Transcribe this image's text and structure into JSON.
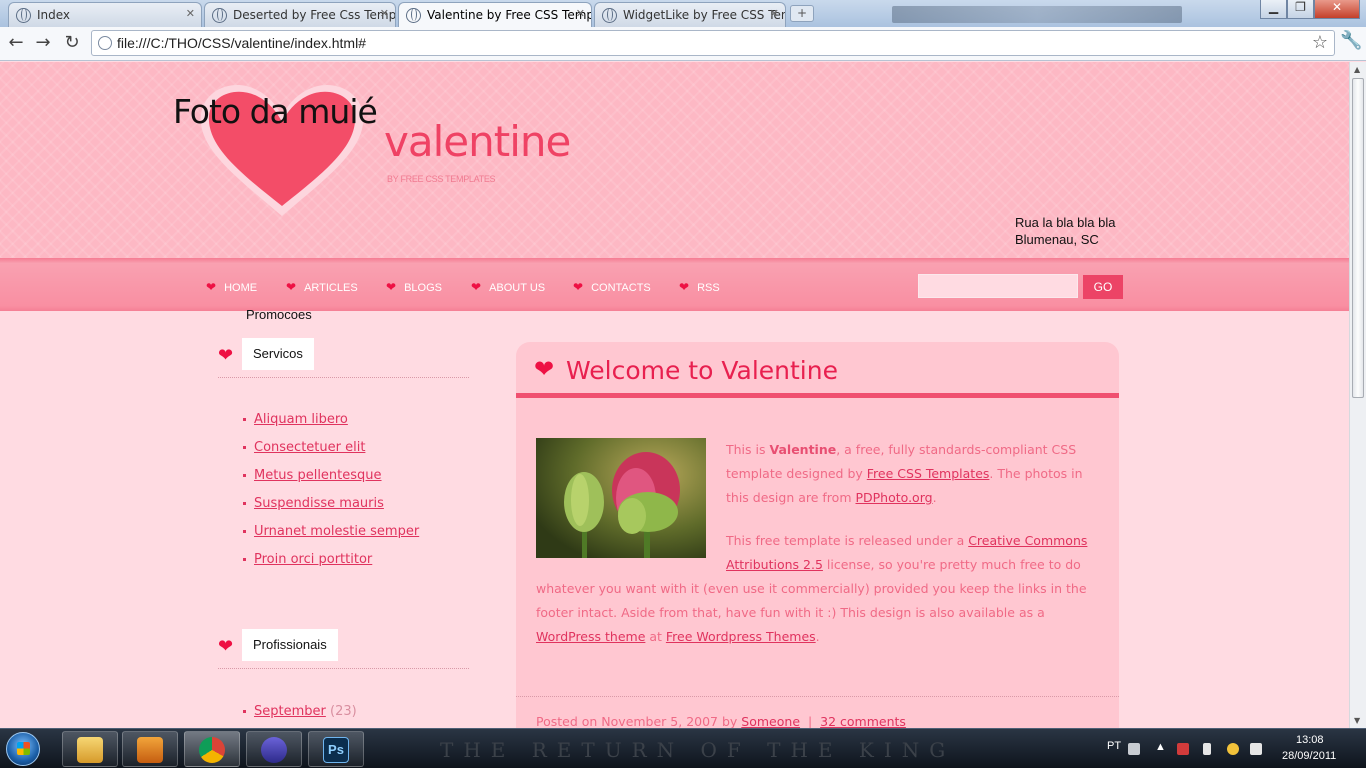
{
  "browser": {
    "tabs": [
      {
        "title": "Index",
        "active": false
      },
      {
        "title": "Deserted by Free Css Templ",
        "active": false
      },
      {
        "title": "Valentine by Free CSS Temp",
        "active": true
      },
      {
        "title": "WidgetLike by Free CSS Ten",
        "active": false
      }
    ],
    "url": "file:///C:/THO/CSS/valentine/index.html#"
  },
  "header": {
    "photo_caption": "Foto da muié",
    "site_title": "valentine",
    "tagline": "BY FREE CSS TEMPLATES",
    "address_line1": "Rua la bla bla bla",
    "address_line2": "Blumenau, SC"
  },
  "menu": {
    "items": [
      "HOME",
      "ARTICLES",
      "BLOGS",
      "ABOUT US",
      "CONTACTS",
      "RSS"
    ],
    "search_button": "GO",
    "search_value": ""
  },
  "sidebar": {
    "promo_label": "Promocoes",
    "sections": [
      {
        "title": "Servicos",
        "items": [
          "Aliquam libero",
          "Consectetuer elit",
          "Metus pellentesque",
          "Suspendisse mauris",
          "Urnanet molestie semper",
          "Proin orci porttitor"
        ]
      },
      {
        "title": "Profissionais",
        "items": [
          {
            "label": "September",
            "count": "(23)"
          }
        ]
      }
    ]
  },
  "post": {
    "title": "Welcome to Valentine",
    "p1": {
      "t1": "This is ",
      "b1": "Valentine",
      "t2": ", a free, fully standards-compliant CSS template designed by ",
      "l1": "Free CSS Templates",
      "t3": ". The photos in this design are from ",
      "l2": "PDPhoto.org",
      "t4": "."
    },
    "p2": {
      "t1": "This free template is released under a ",
      "l1": "Creative Commons Attributions 2.5",
      "t2": " license, so you're pretty much free to do whatever you want with it (even use it commercially) provided you keep the links in the footer intact. Aside from that, have fun with it :) This design is also available as a ",
      "l2": "WordPress theme",
      "t3": " at ",
      "l3": "Free Wordpress Themes",
      "t4": "."
    },
    "footer": {
      "posted_on": "Posted on November 5, 2007 by ",
      "author": "Someone",
      "separator": "|",
      "comments": "32 comments"
    }
  },
  "taskbar": {
    "background_text": "THE RETURN OF THE KING",
    "language": "PT",
    "time": "13:08",
    "date": "28/09/2011"
  },
  "icons": {
    "heart": "heart-icon",
    "globe": "globe-icon",
    "star": "bookmark-star-icon",
    "wrench": "wrench-icon"
  },
  "colors": {
    "accent": "#ee1144",
    "link": "#e0335e",
    "body_text": "#f06a86",
    "page_bg": "#ffdbe2"
  }
}
